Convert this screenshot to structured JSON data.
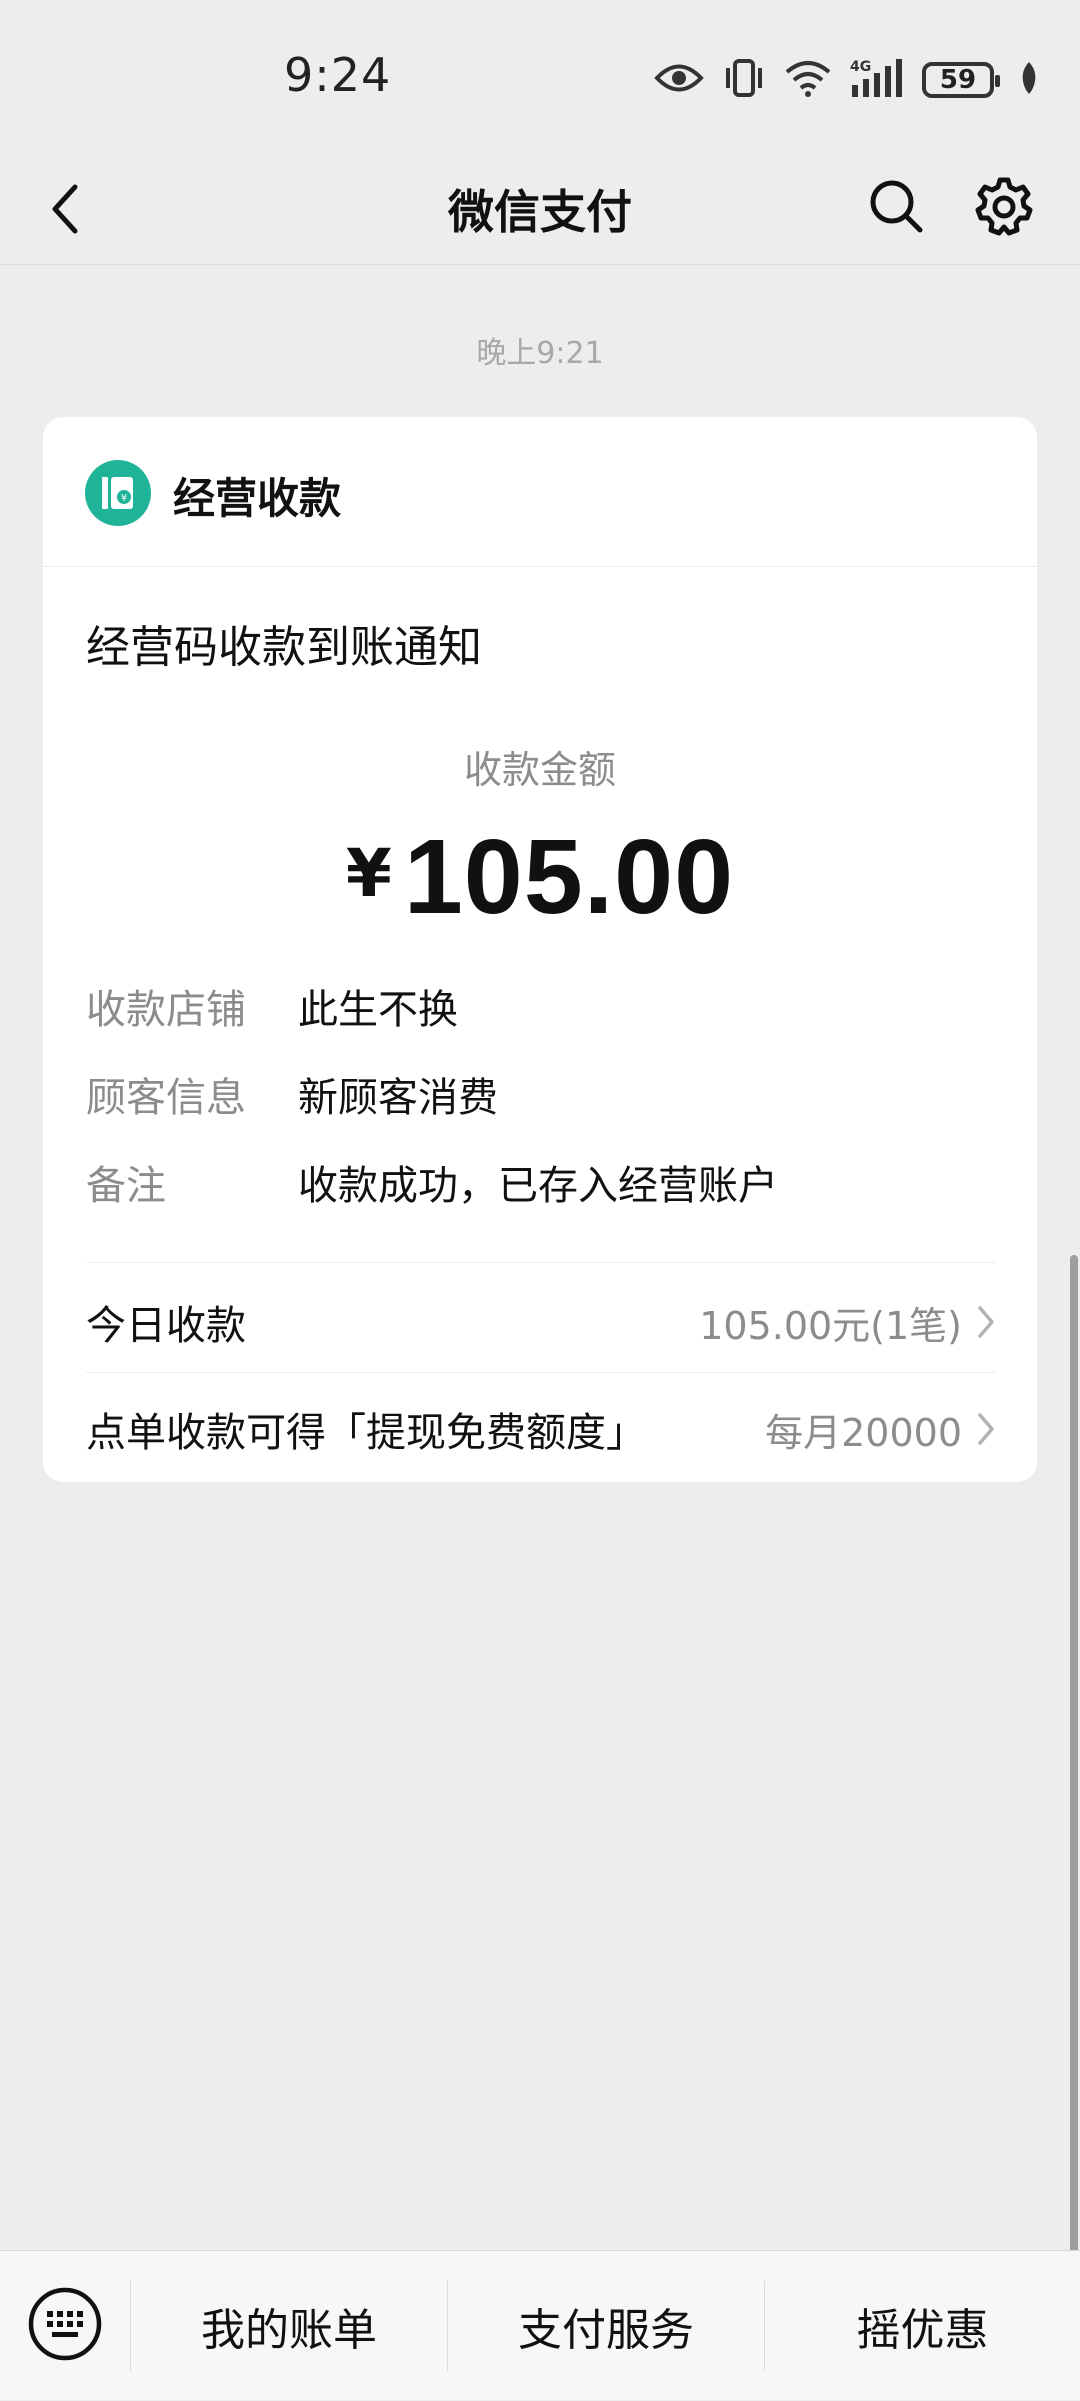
{
  "status_bar": {
    "time": "9:24",
    "battery": "59",
    "icons": [
      "eye-icon",
      "vibrate-icon",
      "wifi-icon",
      "signal-4g-icon",
      "battery-icon",
      "leaf-icon"
    ]
  },
  "nav": {
    "title": "微信支付",
    "icons": [
      "back-icon",
      "search-icon",
      "gear-icon"
    ]
  },
  "timestamp": "晚上9:21",
  "card": {
    "app_name": "经营收款",
    "app_icon": "merchant-receipt-icon",
    "accent_color": "#1fb497",
    "title": "经营码收款到账通知",
    "amount_label": "收款金额",
    "currency": "¥",
    "amount": "105.00",
    "details": [
      {
        "label": "收款店铺",
        "value": "此生不换"
      },
      {
        "label": "顾客信息",
        "value": "新顾客消费"
      },
      {
        "label": "备注",
        "value": "收款成功，已存入经营账户"
      }
    ],
    "today": {
      "label": "今日收款",
      "value": "105.00元(1笔)"
    },
    "promo": {
      "label": "点单收款可得「提现免费额度」",
      "value": "每月20000"
    }
  },
  "bottom_bar": {
    "keyboard_icon": "keyboard-icon",
    "menus": [
      "我的账单",
      "支付服务",
      "摇优惠"
    ]
  }
}
